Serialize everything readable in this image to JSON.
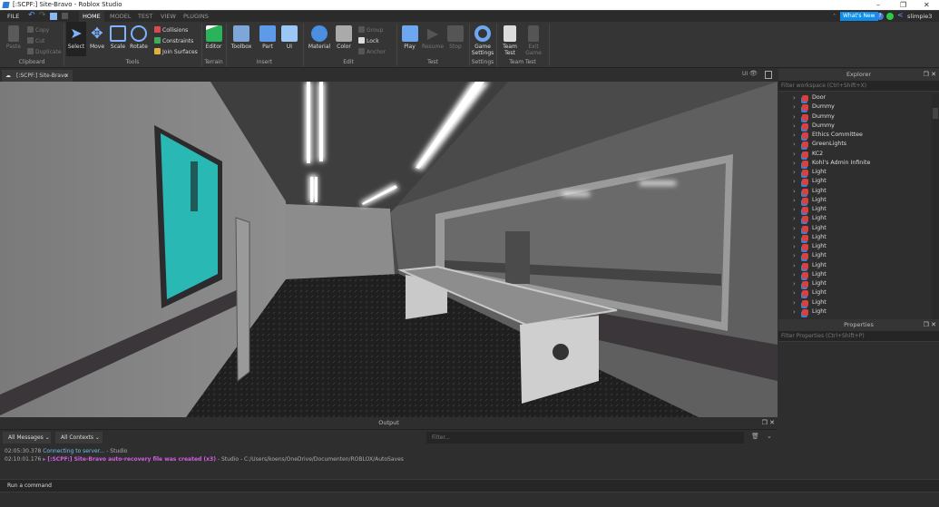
{
  "window": {
    "title": "[:SCPF:] Site-Bravo - Roblox Studio",
    "minimize": "–",
    "restore": "❐",
    "close": "✕"
  },
  "menu": {
    "file": "FILE",
    "tabs": [
      "HOME",
      "MODEL",
      "TEST",
      "VIEW",
      "PLUGINS"
    ],
    "whats_new": "What's New",
    "user": "slimpie3",
    "help": "?"
  },
  "ribbon": {
    "clipboard": {
      "paste": "Paste",
      "copy": "Copy",
      "cut": "Cut",
      "duplicate": "Duplicate",
      "group": "Clipboard"
    },
    "tools": {
      "select": "Select",
      "move": "Move",
      "scale": "Scale",
      "rotate": "Rotate",
      "collisions": "Collisions",
      "constraints": "Constraints",
      "join": "Join Surfaces",
      "group": "Tools"
    },
    "terrain": {
      "editor": "Editor",
      "group": "Terrain"
    },
    "insert": {
      "toolbox": "Toolbox",
      "part": "Part",
      "ui": "UI",
      "group": "Insert"
    },
    "edit": {
      "material": "Material",
      "color": "Color",
      "grp": "Group",
      "lock": "Lock",
      "anchor": "Anchor",
      "group": "Edit"
    },
    "test": {
      "play": "Play",
      "resume": "Resume",
      "stop": "Stop",
      "group": "Test"
    },
    "settings": {
      "game1": "Game",
      "game2": "Settings",
      "group": "Settings"
    },
    "teamtest": {
      "team1": "Team",
      "team2": "Test",
      "exit1": "Exit",
      "exit2": "Game",
      "group": "Team Test"
    }
  },
  "doc_tab": {
    "label": "[:SCPF:] Site-Bravo",
    "close": "×",
    "ui_toggle": "UI"
  },
  "explorer": {
    "title": "Explorer",
    "filter_placeholder": "Filter workspace (Ctrl+Shift+X)",
    "items": [
      "Door",
      "Dummy",
      "Dummy",
      "Dummy",
      "Ethics Committee",
      "GreenLights",
      "KC2",
      "Kohl's Admin Infinite",
      "Light",
      "Light",
      "Light",
      "Light",
      "Light",
      "Light",
      "Light",
      "Light",
      "Light",
      "Light",
      "Light",
      "Light",
      "Light",
      "Light",
      "Light",
      "Light"
    ]
  },
  "properties": {
    "title": "Properties",
    "filter_placeholder": "Filter Properties (Ctrl+Shift+P)"
  },
  "output": {
    "title": "Output",
    "messages_filter": "All Messages",
    "contexts_filter": "All Contexts",
    "filter_placeholder": "Filter...",
    "lines": [
      {
        "time": "02:05:30.378",
        "msg": "Connecting to server...",
        "rest": " - Studio",
        "color": "#6fc3e8"
      },
      {
        "time": "02:10:01.176",
        "msg": "▸ [:SCPF:] Site-Bravo auto-recovery file was created (x3)",
        "rest": " - Studio - C:/Users/koens/OneDrive/Documenten/ROBLOX/AutoSaves",
        "color": "#d35fe0"
      }
    ]
  },
  "command": {
    "placeholder": "Run a command"
  },
  "colors": {
    "accent": "#0e8ee9",
    "poster": "#2ab8b4"
  }
}
